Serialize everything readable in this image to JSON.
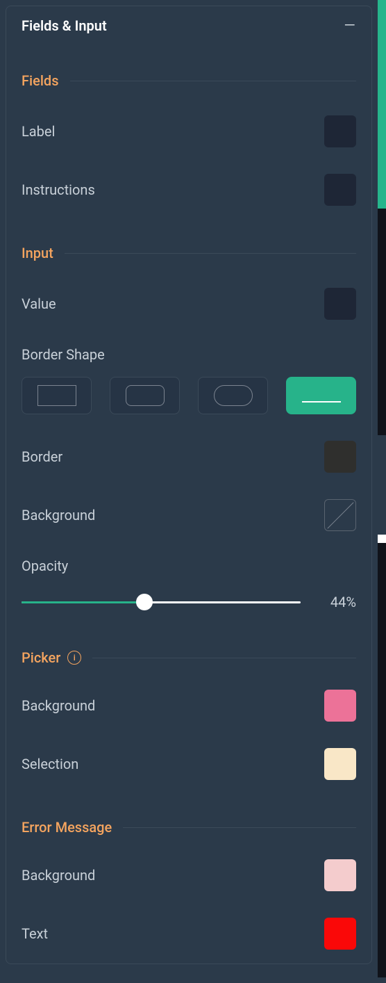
{
  "panel": {
    "title": "Fields & Input"
  },
  "fields": {
    "heading": "Fields",
    "label_label": "Label",
    "instructions_label": "Instructions"
  },
  "input": {
    "heading": "Input",
    "value_label": "Value",
    "border_shape_label": "Border Shape",
    "border_label": "Border",
    "background_label": "Background",
    "opacity_label": "Opacity",
    "opacity_value": "44%",
    "opacity_percent": 44,
    "selected_shape": "underline",
    "shapes": [
      "sharp",
      "rounded",
      "pill",
      "underline"
    ]
  },
  "picker": {
    "heading": "Picker",
    "background_label": "Background",
    "selection_label": "Selection",
    "background_color": "#ec7298",
    "selection_color": "#f9e7c7"
  },
  "error": {
    "heading": "Error Message",
    "background_label": "Background",
    "text_label": "Text",
    "background_color": "#f4cccd",
    "text_color": "#fa0808"
  },
  "other_colors": {
    "accent_green": "#27b38a",
    "heading_orange": "#f4a45f",
    "dark_swatch": "#1e2636",
    "charcoal_swatch": "#2f2f2d"
  }
}
